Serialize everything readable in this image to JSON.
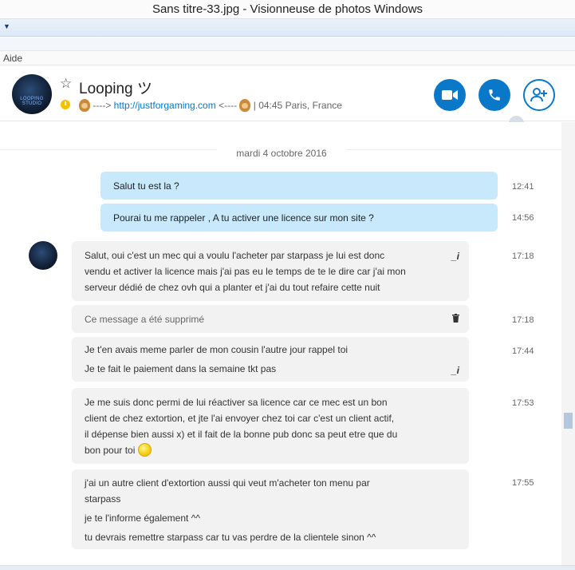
{
  "window": {
    "title": "Sans titre-33.jpg - Visionneuse de photos Windows"
  },
  "menu": {
    "help": "Aide"
  },
  "contact": {
    "name": "Looping ツ",
    "avatar_label": "LOOPING STUDIO",
    "mood_prefix": "----> ",
    "mood_link": "http://justforgaming.com",
    "mood_suffix": " <----",
    "location": "| 04:45 Paris, France"
  },
  "icons": {
    "favorite": "star-icon",
    "status": "away-clock-icon",
    "video": "video-camera-icon",
    "call": "phone-icon",
    "add": "add-contact-icon",
    "globe": "globe-icon",
    "deleted": "trash-icon",
    "edited": "edit-icon"
  },
  "colors": {
    "accent": "#0a78c8",
    "outgoing_bubble": "#c7e9fb",
    "incoming_bubble": "#f2f2f2"
  },
  "chat": {
    "date_separator": "mardi 4 octobre 2016",
    "messages": [
      {
        "dir": "out",
        "text": "Salut tu est la ?",
        "time": "12:41"
      },
      {
        "dir": "out",
        "text": "Pourai tu me rappeler , A tu activer une licence sur mon site ?",
        "time": "14:56"
      },
      {
        "dir": "in",
        "lines": [
          "Salut, oui c'est un mec qui a voulu l'acheter par starpass je lui est donc",
          "vendu et activer la licence mais j'ai pas eu le temps de te le dire car j'ai mon",
          "serveur dédié de chez ovh qui a planter et j'ai du tout refaire cette nuit"
        ],
        "time": "17:18",
        "edited_mark": "_i"
      },
      {
        "dir": "in",
        "text": "Ce message a été supprimé",
        "time": "17:18"
      },
      {
        "dir": "in",
        "lines": [
          "Je t'en avais meme parler de mon cousin l'autre jour rappel toi",
          "Je te fait le paiement dans la semaine tkt pas"
        ],
        "time": "17:44",
        "edited_mark": "_i"
      },
      {
        "dir": "in",
        "lines": [
          "Je me suis donc permi de lui réactiver sa licence car ce mec est un bon",
          "client de chez extortion, et jte l'ai envoyer chez toi  car c'est un client actif,",
          "il dépense bien aussi x)    et il fait de la bonne pub donc sa peut etre que du",
          "bon pour toi"
        ],
        "time": "17:53"
      },
      {
        "dir": "in",
        "lines": [
          "j'ai un autre client d'extortion aussi qui veut m'acheter ton menu par",
          "starpass",
          "je te l'informe également ^^",
          "tu devrais remettre starpass car tu vas perdre de la clientele sinon ^^"
        ],
        "time": "17:55"
      }
    ]
  }
}
